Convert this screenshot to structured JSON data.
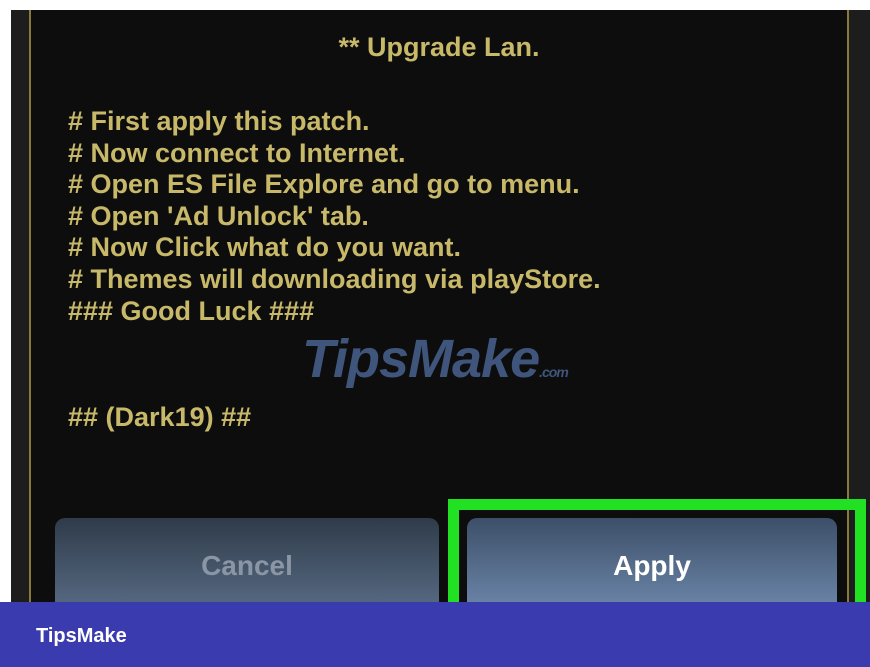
{
  "dialog": {
    "title": "** Upgrade Lan.",
    "instructions": [
      "# First apply this patch.",
      "# Now connect to Internet.",
      "# Open ES File Explore and go to menu.",
      "# Open 'Ad Unlock' tab.",
      "# Now Click what do you want.",
      "# Themes will downloading via playStore.",
      "### Good Luck ###"
    ],
    "signature": "## (Dark19) ##",
    "cancel_label": "Cancel",
    "apply_label": "Apply"
  },
  "watermark": {
    "text": "TipsMake",
    "suffix": ".com"
  },
  "brand": {
    "label": "TipsMake"
  },
  "colors": {
    "text": "#c8b96a",
    "highlight": "#22e022",
    "brand_bar": "#3b3bb0"
  }
}
